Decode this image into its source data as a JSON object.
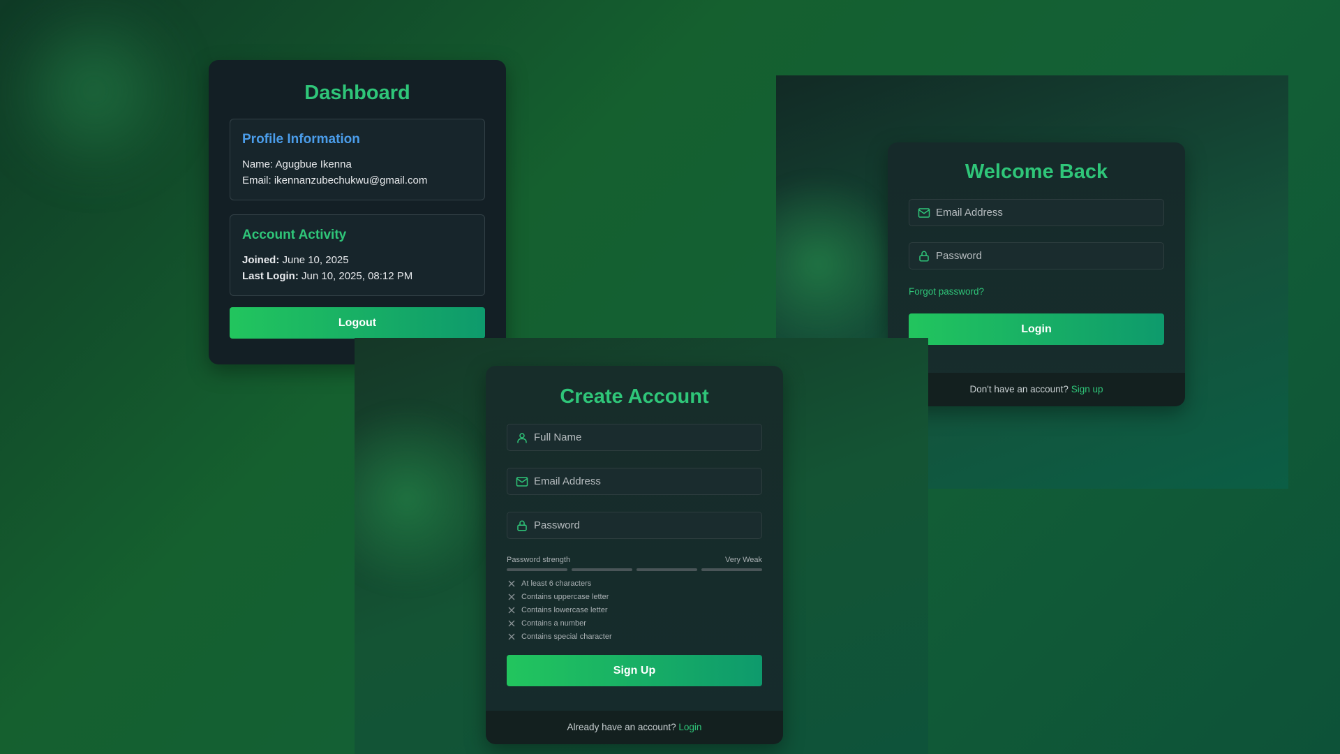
{
  "dashboard": {
    "title": "Dashboard",
    "profile": {
      "heading": "Profile Information",
      "name_line": "Name: Agugbue Ikenna",
      "email_line": "Email: ikennanzubechukwu@gmail.com"
    },
    "activity": {
      "heading": "Account Activity",
      "joined_label": "Joined:",
      "joined_value": " June 10, 2025",
      "last_login_label": "Last Login:",
      "last_login_value": " Jun 10, 2025, 08:12 PM"
    },
    "logout_label": "Logout"
  },
  "login": {
    "title": "Welcome Back",
    "email_placeholder": "Email Address",
    "password_placeholder": "Password",
    "forgot_label": "Forgot password?",
    "login_label": "Login",
    "footer_text": "Don't have an account? ",
    "footer_link": "Sign up"
  },
  "signup": {
    "title": "Create Account",
    "fullname_placeholder": "Full Name",
    "email_placeholder": "Email Address",
    "password_placeholder": "Password",
    "strength_label": "Password strength",
    "strength_value": "Very Weak",
    "strength_level": 0,
    "requirements": [
      "At least 6 characters",
      "Contains uppercase letter",
      "Contains lowercase letter",
      "Contains a number",
      "Contains special character"
    ],
    "signup_label": "Sign Up",
    "footer_text": "Already have an account? ",
    "footer_link": "Login"
  },
  "icons": {
    "email": "mail-icon",
    "password": "lock-icon",
    "name": "user-icon",
    "requirement": "x-icon"
  },
  "colors": {
    "accent": "#2fc679",
    "profile_heading": "#4b9dea",
    "button_start": "#22c55e",
    "button_end": "#0e9a6c"
  }
}
